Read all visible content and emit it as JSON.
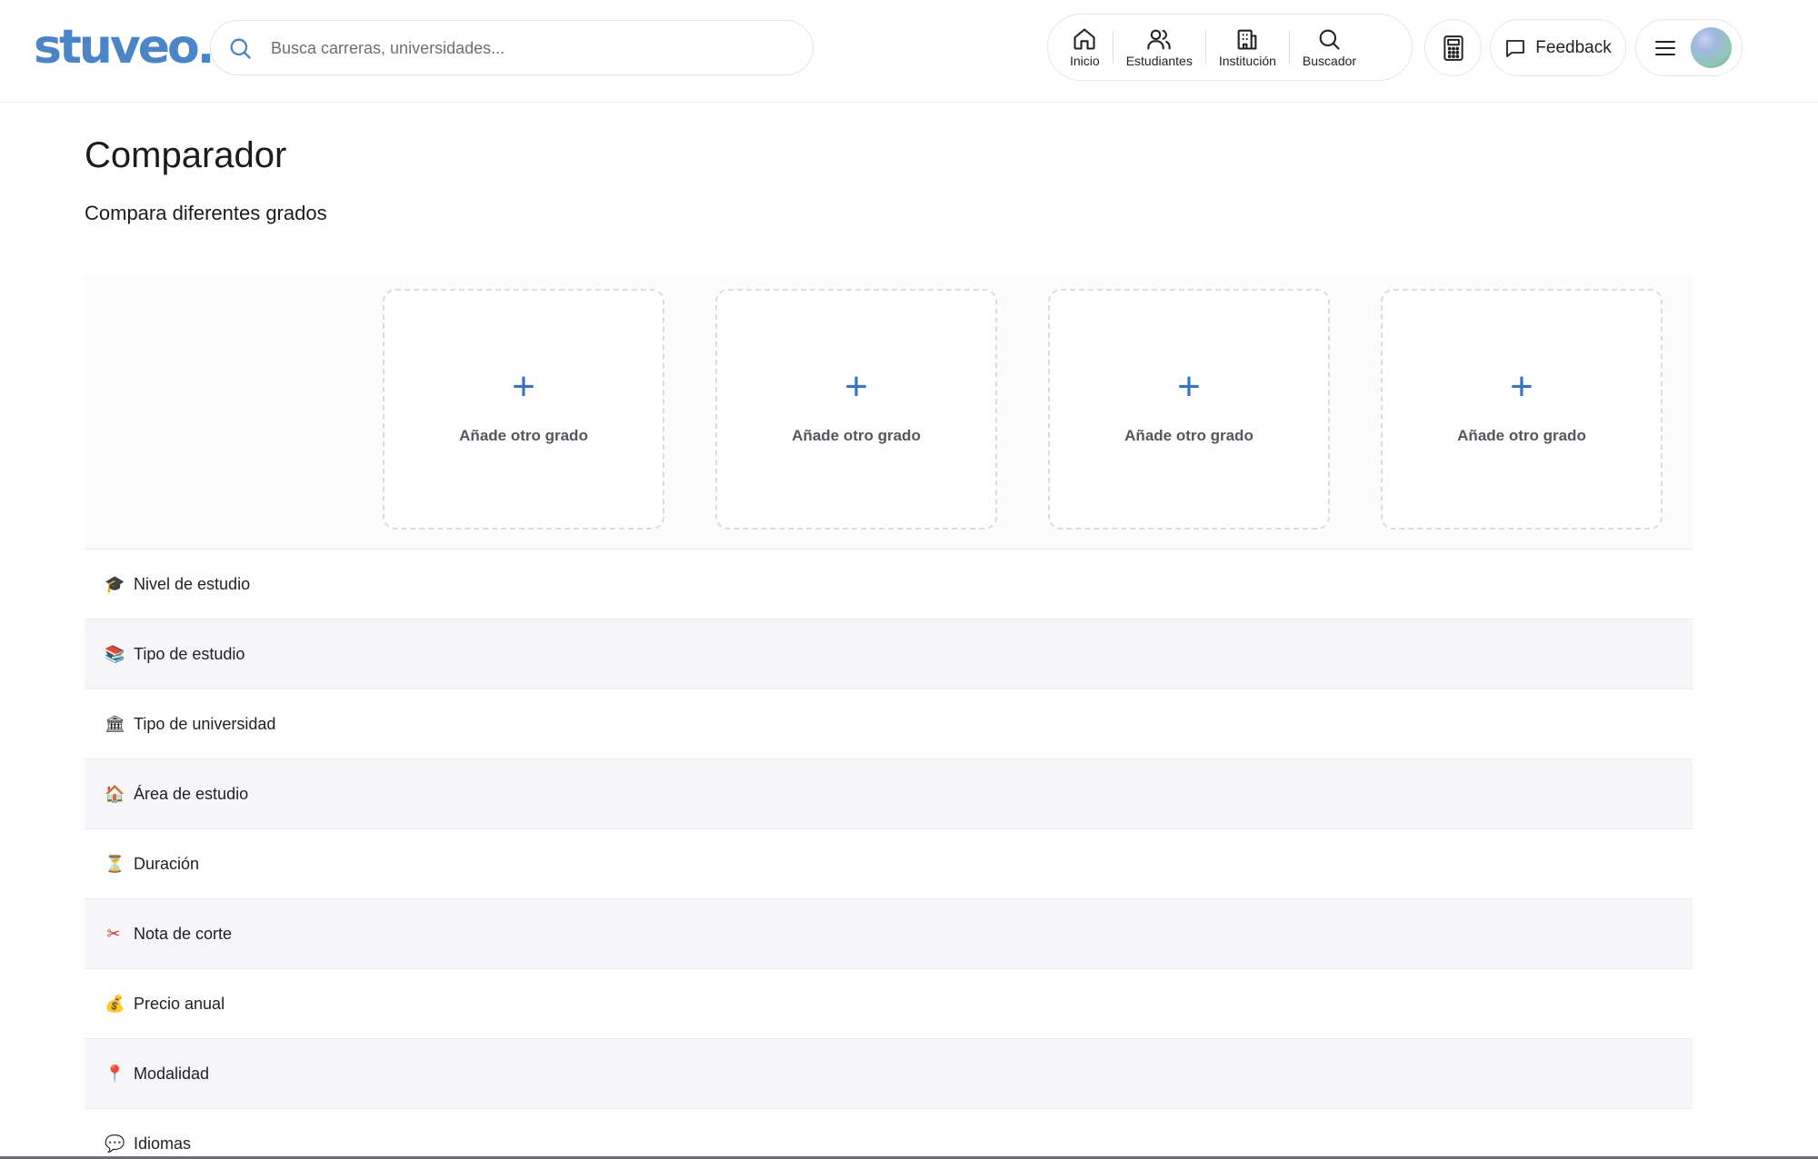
{
  "brand": {
    "logo_text": "stuveo.",
    "accent_color": "#4b85c8"
  },
  "search": {
    "placeholder": "Busca carreras, universidades...",
    "icon": "search-icon"
  },
  "nav": {
    "items": [
      {
        "label": "Inicio",
        "icon": "home-icon"
      },
      {
        "label": "Estudiantes",
        "icon": "users-icon"
      },
      {
        "label": "Institución",
        "icon": "building-icon"
      },
      {
        "label": "Buscador",
        "icon": "search-icon"
      }
    ]
  },
  "toolbar": {
    "calculator_icon": "calculator-icon",
    "feedback_label": "Feedback",
    "feedback_icon": "chat-icon",
    "menu_icon": "hamburger-icon"
  },
  "page": {
    "title": "Comparador",
    "subtitle": "Compara diferentes grados"
  },
  "slots": [
    {
      "label": "Añade otro grado",
      "icon": "plus-icon"
    },
    {
      "label": "Añade otro grado",
      "icon": "plus-icon"
    },
    {
      "label": "Añade otro grado",
      "icon": "plus-icon"
    },
    {
      "label": "Añade otro grado",
      "icon": "plus-icon"
    }
  ],
  "rows": [
    {
      "emoji": "🎓",
      "label": "Nivel de estudio"
    },
    {
      "emoji": "📚",
      "label": "Tipo de estudio"
    },
    {
      "emoji": "🏛",
      "label": "Tipo de universidad"
    },
    {
      "emoji": "🏠",
      "label": "Área de estudio"
    },
    {
      "emoji": "⏳",
      "label": "Duración"
    },
    {
      "emoji": "✂",
      "label": "Nota de corte"
    },
    {
      "emoji": "💰",
      "label": "Precio anual"
    },
    {
      "emoji": "📍",
      "label": "Modalidad"
    },
    {
      "emoji": "💬",
      "label": "Idiomas"
    }
  ]
}
